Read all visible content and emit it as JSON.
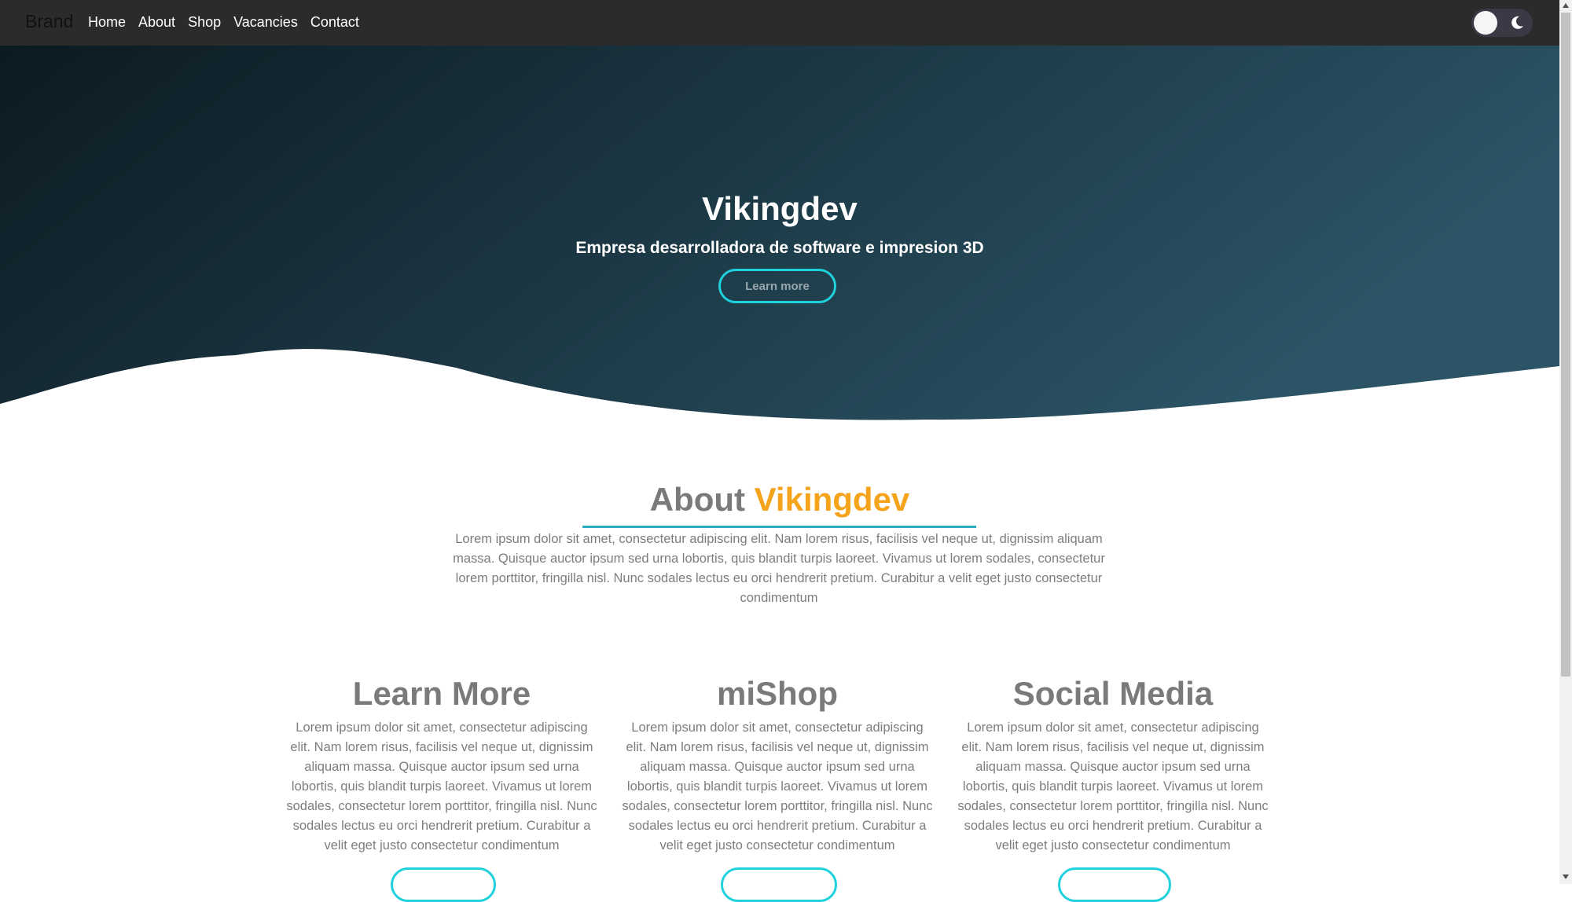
{
  "navbar": {
    "brand": "Brand",
    "links": [
      "Home",
      "About",
      "Shop",
      "Vacancies",
      "Contact"
    ]
  },
  "theme_toggle": {
    "knob_icon": "circle",
    "icon": "moon-icon"
  },
  "hero": {
    "title": "Vikingdev",
    "subtitle": "Empresa desarrolladora de software e impresion 3D",
    "button_label": "Learn more"
  },
  "about": {
    "heading_prefix": "About ",
    "heading_accent": "Vikingdev",
    "text": "Lorem ipsum dolor sit amet, consectetur adipiscing elit. Nam lorem risus, facilisis vel neque ut, dignissim aliquam massa. Quisque auctor ipsum sed urna lobortis, quis blandit turpis laoreet. Vivamus ut lorem sodales, consectetur lorem porttitor, fringilla nisl. Nunc sodales lectus eu orci hendrerit pretium. Curabitur a velit eget justo consectetur condimentum"
  },
  "columns": [
    {
      "title": "Learn More",
      "text": "Lorem ipsum dolor sit amet, consectetur adipiscing elit. Nam lorem risus, facilisis vel neque ut, dignissim aliquam massa. Quisque auctor ipsum sed urna lobortis, quis blandit turpis laoreet. Vivamus ut lorem sodales, consectetur lorem porttitor, fringilla nisl. Nunc sodales lectus eu orci hendrerit pretium. Curabitur a velit eget justo consectetur condimentum"
    },
    {
      "title": "miShop",
      "text": "Lorem ipsum dolor sit amet, consectetur adipiscing elit. Nam lorem risus, facilisis vel neque ut, dignissim aliquam massa. Quisque auctor ipsum sed urna lobortis, quis blandit turpis laoreet. Vivamus ut lorem sodales, consectetur lorem porttitor, fringilla nisl. Nunc sodales lectus eu orci hendrerit pretium. Curabitur a velit eget justo consectetur condimentum"
    },
    {
      "title": "Social Media",
      "text": "Lorem ipsum dolor sit amet, consectetur adipiscing elit. Nam lorem risus, facilisis vel neque ut, dignissim aliquam massa. Quisque auctor ipsum sed urna lobortis, quis blandit turpis laoreet. Vivamus ut lorem sodales, consectetur lorem porttitor, fringilla nisl. Nunc sodales lectus eu orci hendrerit pretium. Curabitur a velit eget justo consectetur condimentum"
    }
  ],
  "colors": {
    "navbar": "#2b2b2b",
    "hero_gradient_start": "#0c1a21",
    "hero_gradient_end": "#2b5466",
    "accent_cyan": "#1fd1dc",
    "accent_orange": "#f5a31a",
    "heading_gray": "#7a7a7a"
  }
}
